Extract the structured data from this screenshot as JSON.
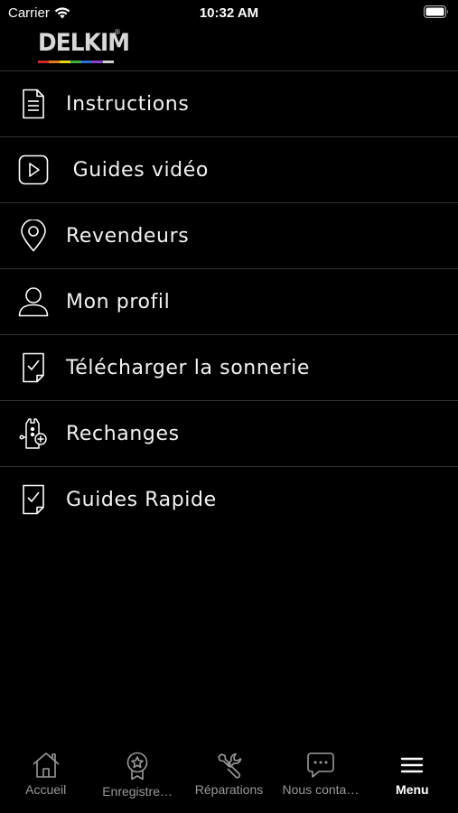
{
  "status_bar": {
    "carrier": "Carrier",
    "time": "10:32 AM"
  },
  "logo": {
    "text": "DELKIM",
    "registered": "®",
    "stripe_colors": [
      "#cc2a2a",
      "#e07a1f",
      "#e8d21a",
      "#3fae3f",
      "#2c6fd1",
      "#8a3fc8",
      "#d0d0d0"
    ]
  },
  "menu": {
    "items": [
      {
        "label": "Instructions",
        "icon": "document-icon"
      },
      {
        "label": " Guides vidéo",
        "icon": "play-video-icon"
      },
      {
        "label": "Revendeurs",
        "icon": "location-pin-icon"
      },
      {
        "label": "Mon profil",
        "icon": "user-icon"
      },
      {
        "label": "Télécharger la sonnerie",
        "icon": "checked-document-icon"
      },
      {
        "label": "Rechanges",
        "icon": "spare-parts-icon"
      },
      {
        "label": "Guides Rapide",
        "icon": "checked-document-icon"
      }
    ]
  },
  "tab_bar": {
    "tabs": [
      {
        "label": "Accueil",
        "icon": "home-icon",
        "active": false
      },
      {
        "label": "Enregistre…",
        "icon": "award-icon",
        "active": false
      },
      {
        "label": "Réparations",
        "icon": "wrench-icon",
        "active": false
      },
      {
        "label": "Nous conta…",
        "icon": "chat-icon",
        "active": false
      },
      {
        "label": "Menu",
        "icon": "menu-icon",
        "active": true
      }
    ],
    "inactive_color": "#9a9a9a",
    "active_color": "#ffffff"
  },
  "colors": {
    "background": "#000000",
    "divider": "#333333",
    "text": "#f2f2f2"
  }
}
